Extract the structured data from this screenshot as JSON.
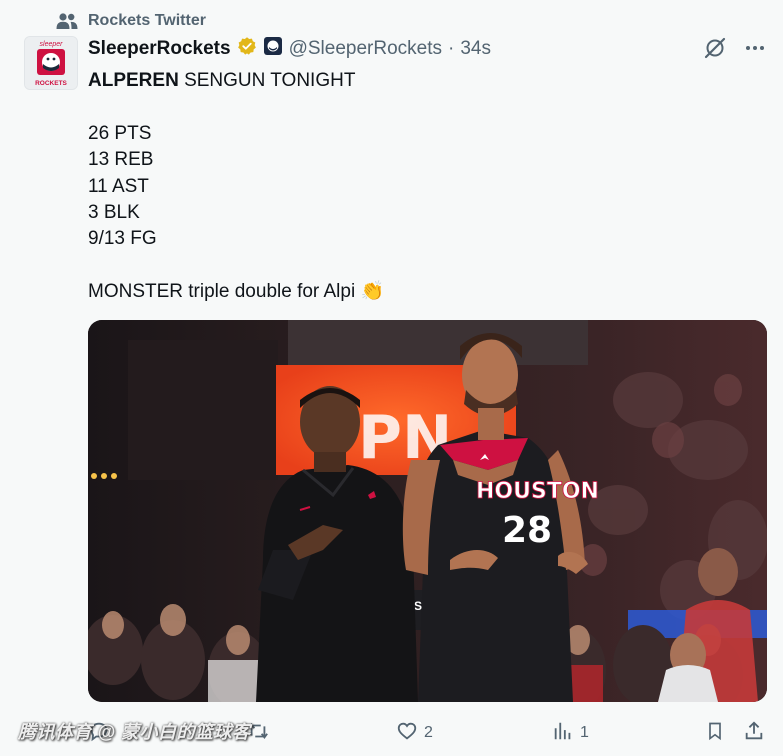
{
  "social_context": {
    "icon": "people-icon",
    "label": "Rockets Twitter"
  },
  "author": {
    "avatar_text_top": "sleeper",
    "avatar_text_bottom": "ROCKETS",
    "display_name": "SleeperRockets",
    "verified_icon": "verified-badge-icon",
    "affiliate_icon": "affiliate-badge-icon",
    "handle": "@SleeperRockets",
    "separator": "·",
    "timestamp": "34s"
  },
  "top_actions": {
    "grok_icon": "grok-icon",
    "more_icon": "more-icon"
  },
  "text": {
    "first_word": "ALPEREN",
    "line1_rest": " SENGUN TONIGHT",
    "stats": [
      "26 PTS",
      "13 REB",
      "11 AST",
      "3 BLK",
      "9/13 FG"
    ],
    "closing": "MONSTER triple double for Alpi",
    "emoji": "👏"
  },
  "media": {
    "jersey_text": "HOUSTON",
    "jersey_number": "28",
    "arena_sign": "PN",
    "courtside_text": "SCO"
  },
  "actions": {
    "reply_icon": "reply-icon",
    "retweet_icon": "retweet-icon",
    "like_icon": "heart-icon",
    "like_count": "2",
    "views_icon": "views-icon",
    "view_count": "1",
    "bookmark_icon": "bookmark-icon",
    "share_icon": "share-icon"
  },
  "watermark": "腾讯体育 @ 蒙小白的篮球客",
  "colors": {
    "background": "#f7f9f9",
    "secondary_text": "#536471",
    "verified_gold": "#e2b719",
    "rockets_red": "#ce1141"
  }
}
